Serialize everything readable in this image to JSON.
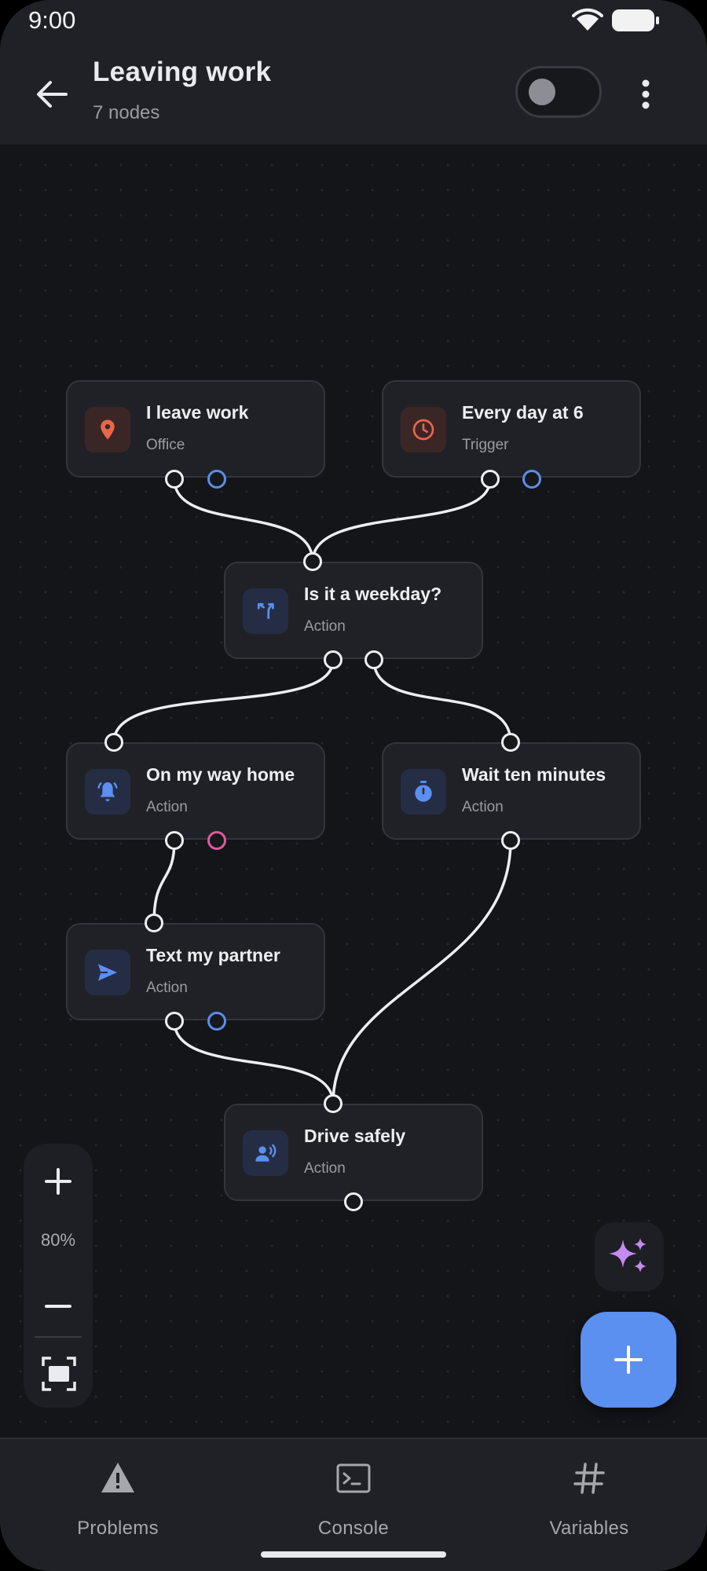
{
  "status_bar": {
    "time": "9:00"
  },
  "header": {
    "title": "Leaving work",
    "subtitle": "7 nodes"
  },
  "nodes": [
    {
      "id": "leave-work",
      "title": "I leave work",
      "subtitle": "Office",
      "icon": "location-pin-icon"
    },
    {
      "id": "every-day",
      "title": "Every day at 6",
      "subtitle": "Trigger",
      "icon": "clock-icon"
    },
    {
      "id": "weekday",
      "title": "Is it a weekday?",
      "subtitle": "Action",
      "icon": "branch-icon"
    },
    {
      "id": "way-home",
      "title": "On my way home",
      "subtitle": "Action",
      "icon": "bell-icon"
    },
    {
      "id": "wait",
      "title": "Wait ten minutes",
      "subtitle": "Action",
      "icon": "stopwatch-icon"
    },
    {
      "id": "text",
      "title": "Text my partner",
      "subtitle": "Action",
      "icon": "send-icon"
    },
    {
      "id": "drive",
      "title": "Drive safely",
      "subtitle": "Action",
      "icon": "voice-person-icon"
    }
  ],
  "zoom": {
    "level": "80%"
  },
  "colors": {
    "accent_blue": "#5b8ff0",
    "trigger_orange": "#e8674a",
    "ai_purple": "#c58bf2",
    "pink_port": "#e05a9a"
  },
  "bottom_nav": [
    {
      "label": "Problems",
      "icon": "warning-icon"
    },
    {
      "label": "Console",
      "icon": "terminal-icon"
    },
    {
      "label": "Variables",
      "icon": "hash-icon"
    }
  ]
}
